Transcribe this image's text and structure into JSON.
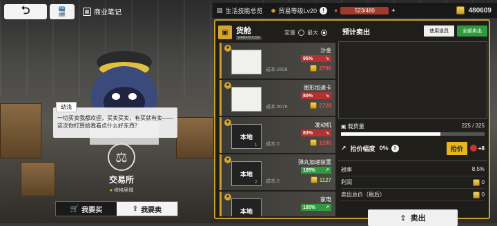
{
  "topbar": {
    "back_icon": "back-arrow-icon",
    "train_icon": "train-icon",
    "notes_label": "商业笔记",
    "skills_label": "生活技能总览",
    "trade_level": "贸易等级Lv20",
    "stamina": "523/480",
    "money": "480609"
  },
  "dialog": {
    "speaker": "幼浅",
    "text": "一切买卖我都欢迎，买卖买卖，有买就有卖——这次你打算给我看点什么好东西？"
  },
  "exchange": {
    "name": "交易所",
    "location": "修格里城"
  },
  "tabs": {
    "buy": "我要买",
    "sell": "我要卖"
  },
  "hold": {
    "title": "货舱",
    "sub": "WAREHOUSE",
    "opt_fixed": "定量",
    "opt_max": "最大"
  },
  "items": [
    {
      "name": "沙金",
      "pct": "95%",
      "cost_label": "成本:",
      "cost": "2608",
      "price": "2796",
      "trend": "red",
      "thumb": "",
      "qty": ""
    },
    {
      "name": "图形加速卡",
      "pct": "80%",
      "cost_label": "成本:",
      "cost": "3076",
      "price": "2728",
      "trend": "red",
      "thumb": "",
      "qty": ""
    },
    {
      "name": "发动机",
      "pct": "83%",
      "cost_label": "成本:",
      "cost": "0",
      "price": "1396",
      "trend": "red",
      "thumb": "本地",
      "qty": "1"
    },
    {
      "name": "弹丸加速装置",
      "pct": "105%",
      "cost_label": "成本:",
      "cost": "0",
      "price": "1127",
      "trend": "green",
      "thumb": "本地",
      "qty": "2"
    },
    {
      "name": "家电",
      "pct": "105%",
      "cost_label": "",
      "cost": "",
      "price": "",
      "trend": "green",
      "thumb": "本地",
      "qty": ""
    }
  ],
  "sell_panel": {
    "title": "预计卖出",
    "use_item": "使用道具",
    "sell_all": "全部卖出",
    "cargo_label": "载货量",
    "cargo_value": "225 / 325",
    "cargo_fill": 0.692,
    "raise_label": "抬价幅度",
    "raise_value": "0%",
    "raise_button": "抬价",
    "raise_cost": "+8",
    "tax_label": "税率",
    "tax_value": "8.5%",
    "profit_label": "利润",
    "profit_value": "0",
    "total_label": "卖出总价（税后）",
    "total_value": "0",
    "sell_button": "卖出"
  }
}
